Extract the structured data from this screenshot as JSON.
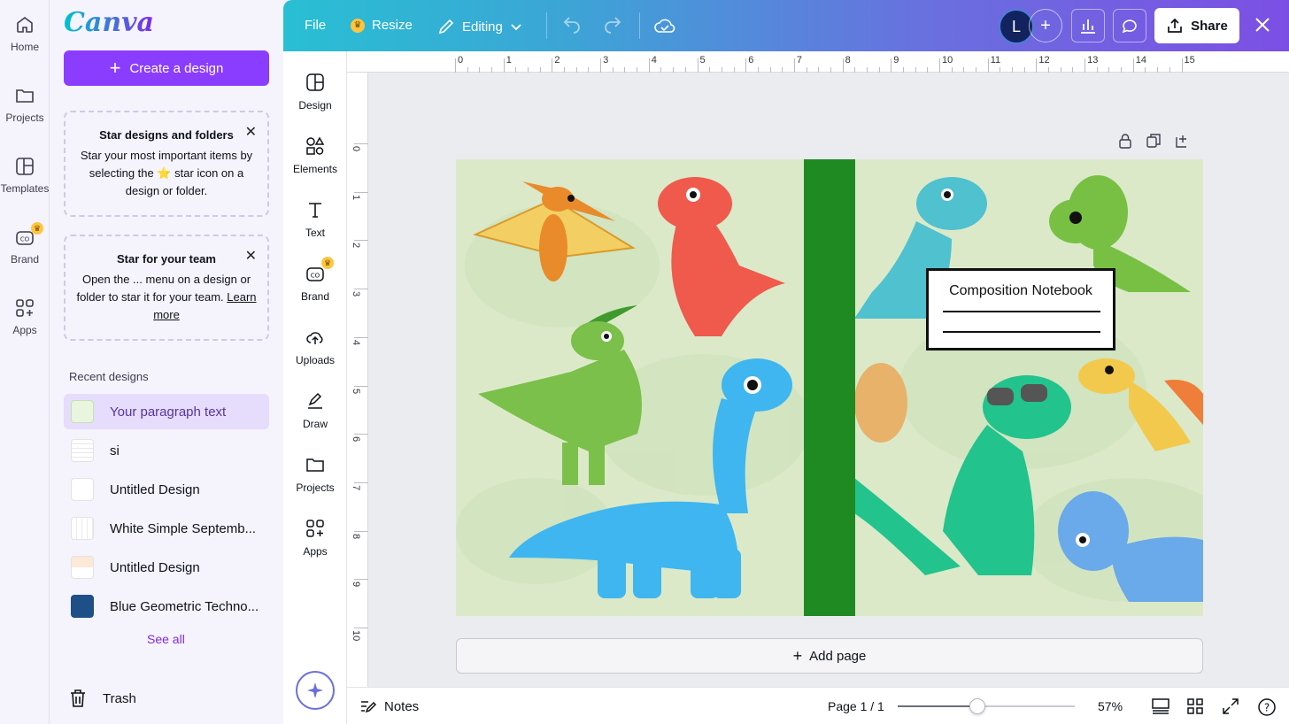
{
  "colors": {
    "accent": "#8b3dff",
    "brand": "#7d2ae8",
    "spine": "#1f8a22",
    "page_bg": "#dbe9c9"
  },
  "rail": {
    "items": [
      {
        "label": "Home",
        "icon": "home-icon"
      },
      {
        "label": "Projects",
        "icon": "folder-icon"
      },
      {
        "label": "Templates",
        "icon": "templates-icon"
      },
      {
        "label": "Brand",
        "icon": "brand-icon"
      },
      {
        "label": "Apps",
        "icon": "apps-icon"
      }
    ]
  },
  "panel": {
    "logo": "Canva",
    "create_label": "Create a design",
    "tips": [
      {
        "title": "Star designs and folders",
        "body_before": "Star your most important items by selecting the ",
        "body_after": " star icon on a design or folder."
      },
      {
        "title": "Star for your team",
        "body_before": "Open the ... menu on a design or folder to star it for your team. ",
        "link": "Learn more"
      }
    ],
    "recent_title": "Recent designs",
    "recent": [
      {
        "name": "Your paragraph text",
        "active": true
      },
      {
        "name": "si"
      },
      {
        "name": "Untitled Design"
      },
      {
        "name": "White Simple Septemb..."
      },
      {
        "name": "Untitled Design"
      },
      {
        "name": "Blue Geometric Techno..."
      }
    ],
    "see_all": "See all",
    "trash": "Trash"
  },
  "topbar": {
    "file": "File",
    "resize": "Resize",
    "editing": "Editing",
    "avatar_initial": "L",
    "share": "Share"
  },
  "objpanel": {
    "items": [
      {
        "label": "Design",
        "icon": "design-icon"
      },
      {
        "label": "Elements",
        "icon": "elements-icon"
      },
      {
        "label": "Text",
        "icon": "text-icon"
      },
      {
        "label": "Brand",
        "icon": "brand-icon"
      },
      {
        "label": "Uploads",
        "icon": "upload-icon"
      },
      {
        "label": "Draw",
        "icon": "draw-icon"
      },
      {
        "label": "Projects",
        "icon": "folder-icon"
      },
      {
        "label": "Apps",
        "icon": "apps-icon"
      }
    ]
  },
  "ruler": {
    "top": [
      "0",
      "1",
      "2",
      "3",
      "4",
      "5",
      "6",
      "7",
      "8",
      "9",
      "10",
      "11",
      "12",
      "13",
      "14",
      "15"
    ],
    "left": [
      "0",
      "1",
      "2",
      "3",
      "4",
      "5",
      "6",
      "7",
      "8",
      "9",
      "10"
    ]
  },
  "canvas": {
    "label_title": "Composition Notebook",
    "add_page": "Add page"
  },
  "bottombar": {
    "notes": "Notes",
    "page": "Page 1 / 1",
    "zoom_label": "57%",
    "zoom_fraction": 0.45
  }
}
